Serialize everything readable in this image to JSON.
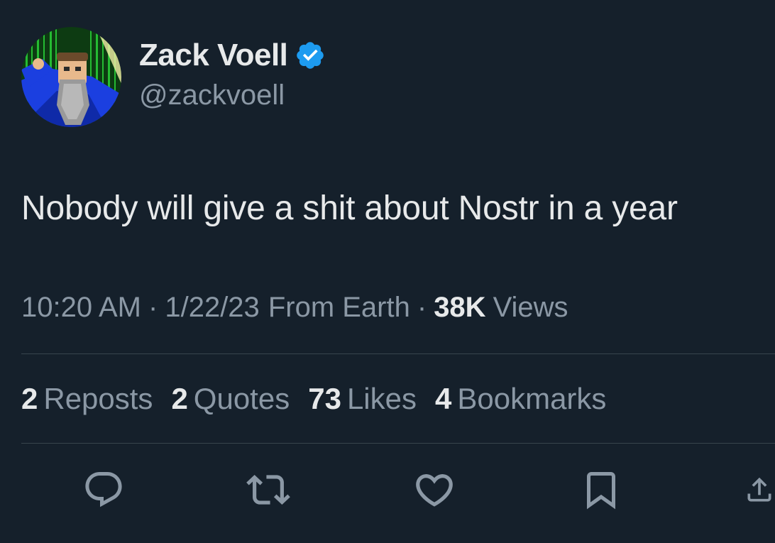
{
  "author": {
    "display_name": "Zack Voell",
    "handle": "@zackvoell",
    "verified": true,
    "verified_color": "#1d9bf0"
  },
  "tweet": {
    "text": "Nobody will give a shit about Nostr in a year"
  },
  "meta": {
    "time": "10:20 AM",
    "separator": "·",
    "date": "1/22/23",
    "source": "From Earth",
    "views_count": "38K",
    "views_label": "Views"
  },
  "stats": {
    "reposts": {
      "count": "2",
      "label": "Reposts"
    },
    "quotes": {
      "count": "2",
      "label": "Quotes"
    },
    "likes": {
      "count": "73",
      "label": "Likes"
    },
    "bookmarks": {
      "count": "4",
      "label": "Bookmarks"
    }
  },
  "actions": [
    {
      "icon": "reply-icon"
    },
    {
      "icon": "repost-icon"
    },
    {
      "icon": "like-icon"
    },
    {
      "icon": "bookmark-icon"
    },
    {
      "icon": "share-icon"
    }
  ],
  "colors": {
    "background": "#15202b",
    "primary_text": "#e7e9ea",
    "secondary_text": "#8b98a5",
    "divider": "#38444d"
  }
}
